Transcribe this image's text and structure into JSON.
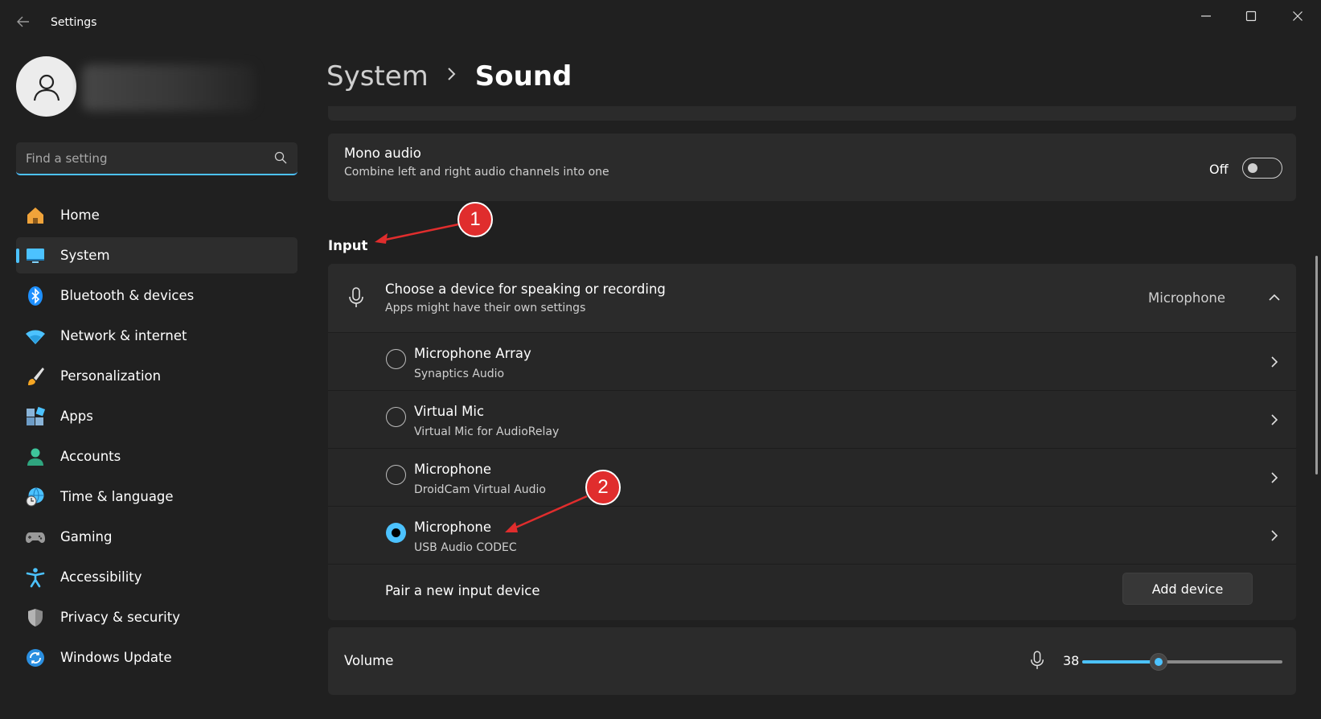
{
  "window": {
    "title": "Settings",
    "back_icon": "back-arrow-icon",
    "controls": [
      "minimize-icon",
      "maximize-icon",
      "close-icon"
    ]
  },
  "search": {
    "placeholder": "Find a setting",
    "value": ""
  },
  "sidebar": {
    "items": [
      {
        "label": "Home",
        "icon": "home-icon",
        "color": "#f0a33a"
      },
      {
        "label": "System",
        "icon": "system-monitor-icon",
        "color": "#4cc2ff",
        "active": true
      },
      {
        "label": "Bluetooth & devices",
        "icon": "bluetooth-icon",
        "color": "#1e90ff"
      },
      {
        "label": "Network & internet",
        "icon": "wifi-icon",
        "color": "#4cc2ff"
      },
      {
        "label": "Personalization",
        "icon": "paintbrush-icon",
        "color": "#f5a623"
      },
      {
        "label": "Apps",
        "icon": "apps-icon",
        "color": "#8ab4d8"
      },
      {
        "label": "Accounts",
        "icon": "accounts-icon",
        "color": "#3ec59b"
      },
      {
        "label": "Time & language",
        "icon": "globe-clock-icon",
        "color": "#4cc2ff"
      },
      {
        "label": "Gaming",
        "icon": "gamepad-icon",
        "color": "#9a9a9a"
      },
      {
        "label": "Accessibility",
        "icon": "accessibility-icon",
        "color": "#4cc2ff"
      },
      {
        "label": "Privacy & security",
        "icon": "shield-icon",
        "color": "#8a8a8a"
      },
      {
        "label": "Windows Update",
        "icon": "update-icon",
        "color": "#2b8fe0"
      }
    ]
  },
  "header": {
    "parent": "System",
    "current": "Sound"
  },
  "mono_audio": {
    "title": "Mono audio",
    "subtitle": "Combine left and right audio channels into one",
    "state_label": "Off"
  },
  "input": {
    "section_title": "Input",
    "chooser": {
      "title": "Choose a device for speaking or recording",
      "subtitle": "Apps might have their own settings",
      "selected_value": "Microphone"
    },
    "devices": [
      {
        "name": "Microphone Array",
        "detail": "Synaptics Audio",
        "selected": false
      },
      {
        "name": "Virtual Mic",
        "detail": "Virtual Mic for AudioRelay",
        "selected": false
      },
      {
        "name": "Microphone",
        "detail": "DroidCam Virtual Audio",
        "selected": false
      },
      {
        "name": "Microphone",
        "detail": "USB Audio CODEC",
        "selected": true
      }
    ],
    "pair": {
      "label": "Pair a new input device",
      "button": "Add device"
    }
  },
  "volume": {
    "label": "Volume",
    "value": "38",
    "fraction": 0.38
  },
  "annotations": {
    "badge_1": "1",
    "badge_2": "2"
  },
  "colors": {
    "accent": "#4cc2ff",
    "badge": "#e02d2d",
    "background": "#202020",
    "card": "#2b2b2b"
  }
}
